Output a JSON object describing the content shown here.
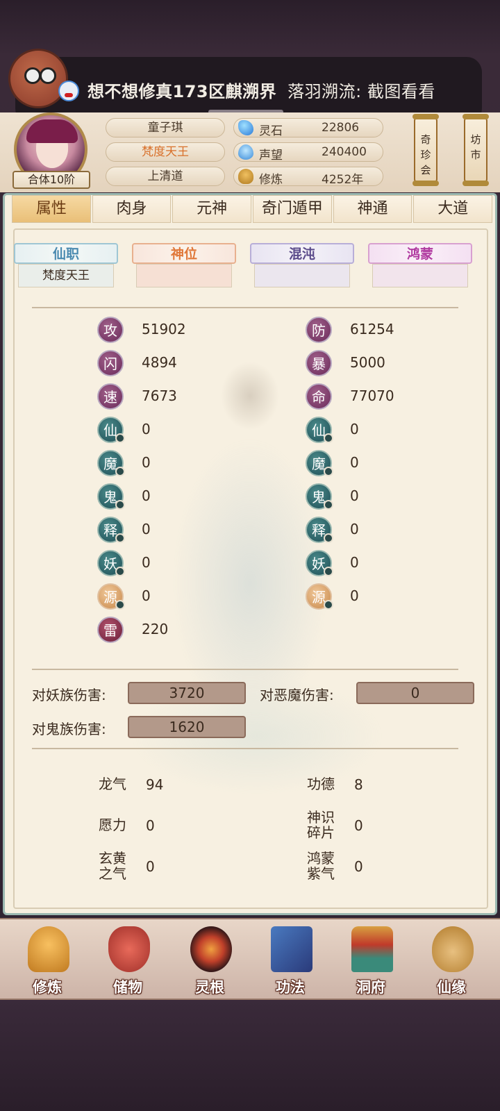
{
  "notification": {
    "title": "想不想修真173区麒溯界",
    "message": "落羽溯流: 截图看看"
  },
  "header": {
    "name": "童子琪",
    "title": "梵度天王",
    "sect": "上清道",
    "realm_badge": "合体10阶",
    "resources": [
      {
        "label": "灵石",
        "value": "22806",
        "icon": "spirit-stone-icon"
      },
      {
        "label": "声望",
        "value": "240400",
        "icon": "reputation-icon"
      },
      {
        "label": "修炼",
        "value": "4252年",
        "icon": "meditation-icon"
      }
    ],
    "buttons": [
      {
        "label": "奇\n珍\n会"
      },
      {
        "label": "坊\n市"
      }
    ]
  },
  "tabs": [
    "属性",
    "肉身",
    "元神",
    "奇门遁甲",
    "神通",
    "大道"
  ],
  "active_tab": 0,
  "categories": [
    {
      "label": "仙职",
      "value": "梵度天王",
      "color": "blue"
    },
    {
      "label": "神位",
      "value": "",
      "color": "red"
    },
    {
      "label": "混沌",
      "value": "",
      "color": "purple"
    },
    {
      "label": "鸿蒙",
      "value": "",
      "color": "magenta"
    }
  ],
  "stats_left": [
    {
      "char": "攻",
      "value": "51902",
      "style": "purple"
    },
    {
      "char": "闪",
      "value": "4894",
      "style": "purple"
    },
    {
      "char": "速",
      "value": "7673",
      "style": "purple"
    },
    {
      "char": "仙",
      "value": "0",
      "style": "teal"
    },
    {
      "char": "魔",
      "value": "0",
      "style": "teal"
    },
    {
      "char": "鬼",
      "value": "0",
      "style": "teal"
    },
    {
      "char": "释",
      "value": "0",
      "style": "teal"
    },
    {
      "char": "妖",
      "value": "0",
      "style": "teal"
    },
    {
      "char": "源",
      "value": "0",
      "style": "orange"
    },
    {
      "char": "雷",
      "value": "220",
      "style": "maroon"
    }
  ],
  "stats_right": [
    {
      "char": "防",
      "value": "61254",
      "style": "purple"
    },
    {
      "char": "暴",
      "value": "5000",
      "style": "purple"
    },
    {
      "char": "命",
      "value": "77070",
      "style": "purple"
    },
    {
      "char": "仙",
      "value": "0",
      "style": "teal"
    },
    {
      "char": "魔",
      "value": "0",
      "style": "teal"
    },
    {
      "char": "鬼",
      "value": "0",
      "style": "teal"
    },
    {
      "char": "释",
      "value": "0",
      "style": "teal"
    },
    {
      "char": "妖",
      "value": "0",
      "style": "teal"
    },
    {
      "char": "源",
      "value": "0",
      "style": "orange"
    }
  ],
  "damage": {
    "yao_label": "对妖族伤害:",
    "yao_value": "3720",
    "demon_label": "对恶魔伤害:",
    "demon_value": "0",
    "ghost_label": "对鬼族伤害:",
    "ghost_value": "1620"
  },
  "misc": {
    "longqi_label": "龙气",
    "longqi_value": "94",
    "gongde_label": "功德",
    "gongde_value": "8",
    "yuanli_label": "愿力",
    "yuanli_value": "0",
    "shenshi_label": "神识碎片",
    "shenshi_value": "0",
    "xuanhuang_label": "玄黄之气",
    "xuanhuang_value": "0",
    "hongmeng_label": "鸿蒙紫气",
    "hongmeng_value": "0"
  },
  "bottom_nav": [
    {
      "label": "修炼",
      "icon": "meditation-icon"
    },
    {
      "label": "储物",
      "icon": "storage-bag-icon"
    },
    {
      "label": "灵根",
      "icon": "spirit-root-icon"
    },
    {
      "label": "功法",
      "icon": "scripture-book-icon"
    },
    {
      "label": "洞府",
      "icon": "cave-mansion-icon"
    },
    {
      "label": "仙缘",
      "icon": "gourd-icon"
    }
  ]
}
